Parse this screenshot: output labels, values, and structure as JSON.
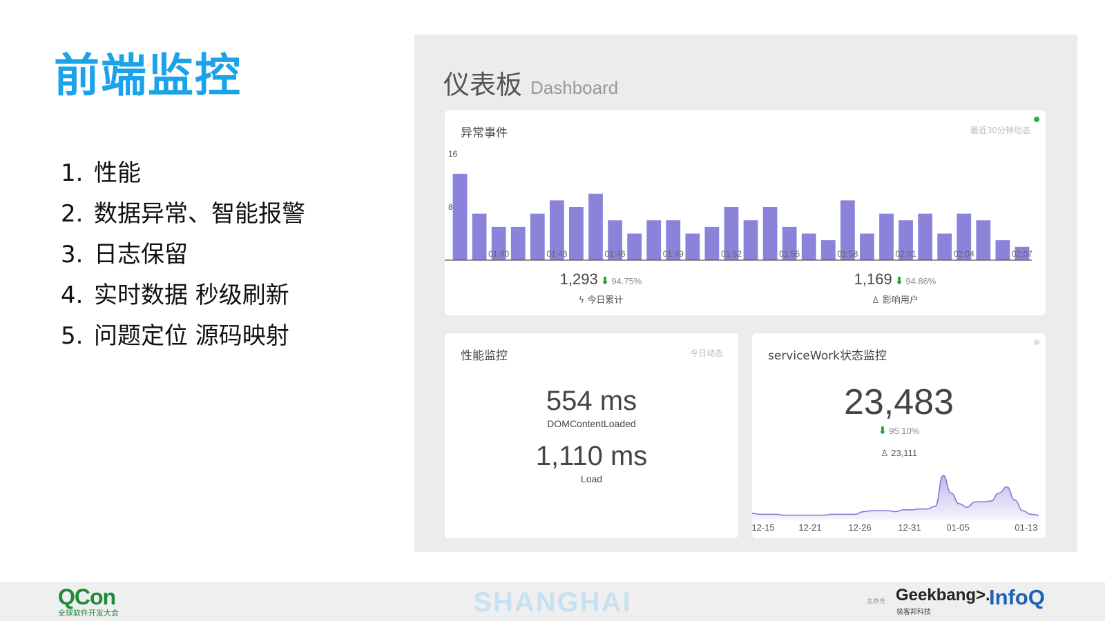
{
  "slide": {
    "title": "前端监控",
    "bullets": [
      {
        "num": "1.",
        "text": "性能"
      },
      {
        "num": "2.",
        "text": "数据异常、智能报警"
      },
      {
        "num": "3.",
        "text": "日志保留"
      },
      {
        "num": "4.",
        "text": "实时数据 秒级刷新"
      },
      {
        "num": "5.",
        "text": "问题定位 源码映射"
      }
    ]
  },
  "dashboard": {
    "title_zh": "仪表板",
    "title_en": "Dashboard",
    "status_colors": {
      "live": "#27b04b",
      "idle": "#dddddd"
    },
    "events_card": {
      "title": "异常事件",
      "note": "最近30分钟动态",
      "today": {
        "value": "1,293",
        "delta": "94.75%",
        "label": "今日累计"
      },
      "users": {
        "value": "1,169",
        "delta": "94.86%",
        "label": "影响用户"
      }
    },
    "perf_card": {
      "title": "性能监控",
      "note": "今日动态",
      "dom_value": "554 ms",
      "dom_label": "DOMContentLoaded",
      "load_value": "1,110 ms",
      "load_label": "Load"
    },
    "sw_card": {
      "title": "serviceWork状态监控",
      "value": "23,483",
      "delta": "95.10%",
      "users": "23,111"
    }
  },
  "footer": {
    "qcon": "QCon",
    "qcon_sub": "全球软件开发大会",
    "city": "SHANGHAI",
    "sponsor_label": "主办方",
    "geekbang": "Geekbang>.",
    "geekbang_sub": "极客邦科技",
    "infoq": "InfoQ"
  },
  "chart_data": [
    {
      "type": "bar",
      "color": "#8a83d9",
      "y_ticks": [
        16,
        8
      ],
      "ylim": [
        0,
        16
      ],
      "x_tick_labels": [
        "01:40",
        "01:43",
        "01:46",
        "01:49",
        "01:52",
        "01:55",
        "01:58",
        "02:01",
        "02:04",
        "02:07"
      ],
      "values": [
        13,
        7,
        5,
        5,
        7,
        9,
        8,
        10,
        6,
        4,
        6,
        6,
        4,
        5,
        8,
        6,
        8,
        5,
        4,
        3,
        9,
        4,
        7,
        6,
        7,
        4,
        7,
        6,
        3,
        2
      ]
    },
    {
      "type": "area",
      "color": "#9b93e0",
      "x_tick_labels": [
        "12-15",
        "12-21",
        "12-26",
        "12-31",
        "01-05",
        "01-13"
      ],
      "values": [
        7,
        6,
        6,
        6,
        5,
        5,
        5,
        5,
        5,
        5,
        6,
        6,
        6,
        6,
        9,
        10,
        10,
        10,
        9,
        11,
        11,
        12,
        12,
        15,
        50,
        30,
        18,
        14,
        20,
        20,
        21,
        30,
        37,
        22,
        10,
        6,
        5
      ]
    }
  ]
}
